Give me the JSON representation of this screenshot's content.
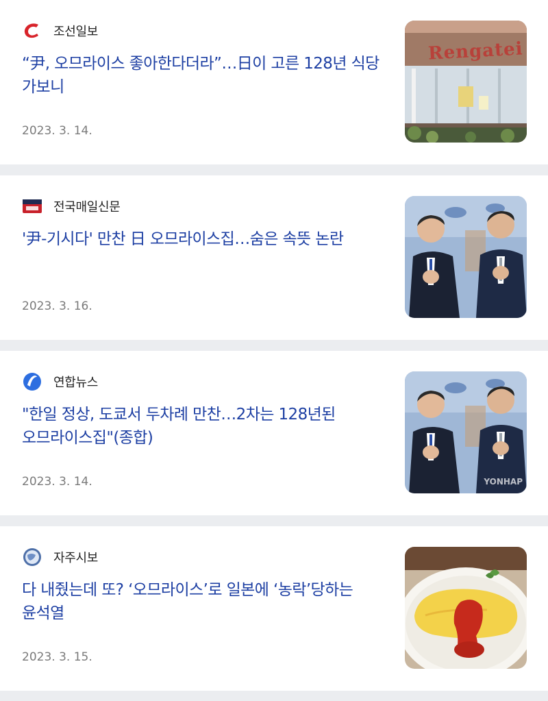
{
  "articles": [
    {
      "press": "조선일보",
      "press_icon": "chosun-logo-icon",
      "headline": "“尹, 오므라이스 좋아한다더라”…日이 고른 128년 식당 가보니",
      "date": "2023. 3. 14.",
      "thumbnail": "restaurant-storefront-image",
      "thumbnail_sign": "Rengatei"
    },
    {
      "press": "전국매일신문",
      "press_icon": "jeonguk-maeil-logo-icon",
      "headline": "'尹-기시다' 만찬 日 오므라이스집…숨은 속뜻 논란",
      "date": "2023. 3. 16.",
      "thumbnail": "leaders-clapping-image"
    },
    {
      "press": "연합뉴스",
      "press_icon": "yonhap-logo-icon",
      "headline": "\"한일 정상, 도쿄서 두차례 만찬…2차는 128년된 오므라이스집\"(종합)",
      "date": "2023. 3. 14.",
      "thumbnail": "leaders-clapping-image",
      "thumbnail_watermark": "YONHAP"
    },
    {
      "press": "자주시보",
      "press_icon": "jajusibo-globe-logo-icon",
      "headline": "다 내줬는데 또? ‘오므라이스’로 일본에 ‘농락’당하는 윤석열",
      "date": "2023. 3. 15.",
      "thumbnail": "omurice-dish-image"
    }
  ],
  "colors": {
    "headline": "#1d3fa3",
    "press_name": "#222222",
    "date": "#7a7a7a",
    "divider": "#ebedf0",
    "chosun_red": "#d8232a",
    "yonhap_blue": "#2d6ee0"
  }
}
